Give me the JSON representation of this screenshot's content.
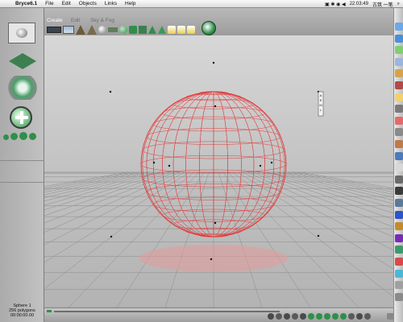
{
  "menubar": {
    "apple": "",
    "items": [
      "Bryce6.1",
      "File",
      "Edit",
      "Objects",
      "Links",
      "Help"
    ],
    "clock": "22:03:49",
    "input_method": "古筑 一笔"
  },
  "palette": {
    "tabs": [
      "Create",
      "Edit",
      "Sky & Fog"
    ]
  },
  "selection": {
    "name": "Sphere 1",
    "polygons": "256 polygons",
    "time": "00:00:00.00"
  },
  "colors": {
    "wireframe": "#e23c3c",
    "accent": "#2f8f4a",
    "ground_grid": "#8c8c8c"
  },
  "dock_icons": [
    "finder-icon",
    "safari-icon",
    "ichat-icon",
    "mail-icon",
    "itunes-icon",
    "calendar-icon",
    "addressbook-icon",
    "preview-icon",
    "ical-icon",
    "system-preferences-icon",
    "app-icon-1",
    "app-icon-2",
    "app-icon-3",
    "app-icon-4",
    "app-icon-5",
    "app-icon-6",
    "photoshop-icon",
    "illustrator-icon",
    "app-icon-7",
    "app-icon-8",
    "app-icon-9",
    "app-icon-10",
    "app-icon-11",
    "trash-icon"
  ]
}
